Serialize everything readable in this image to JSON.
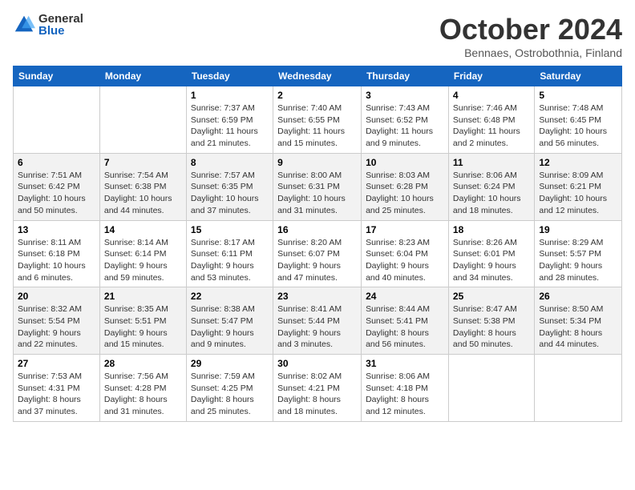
{
  "header": {
    "logo_general": "General",
    "logo_blue": "Blue",
    "month_title": "October 2024",
    "subtitle": "Bennaes, Ostrobothnia, Finland"
  },
  "weekdays": [
    "Sunday",
    "Monday",
    "Tuesday",
    "Wednesday",
    "Thursday",
    "Friday",
    "Saturday"
  ],
  "rows": [
    [
      {
        "day": "",
        "info": ""
      },
      {
        "day": "",
        "info": ""
      },
      {
        "day": "1",
        "info": "Sunrise: 7:37 AM\nSunset: 6:59 PM\nDaylight: 11 hours\nand 21 minutes."
      },
      {
        "day": "2",
        "info": "Sunrise: 7:40 AM\nSunset: 6:55 PM\nDaylight: 11 hours\nand 15 minutes."
      },
      {
        "day": "3",
        "info": "Sunrise: 7:43 AM\nSunset: 6:52 PM\nDaylight: 11 hours\nand 9 minutes."
      },
      {
        "day": "4",
        "info": "Sunrise: 7:46 AM\nSunset: 6:48 PM\nDaylight: 11 hours\nand 2 minutes."
      },
      {
        "day": "5",
        "info": "Sunrise: 7:48 AM\nSunset: 6:45 PM\nDaylight: 10 hours\nand 56 minutes."
      }
    ],
    [
      {
        "day": "6",
        "info": "Sunrise: 7:51 AM\nSunset: 6:42 PM\nDaylight: 10 hours\nand 50 minutes."
      },
      {
        "day": "7",
        "info": "Sunrise: 7:54 AM\nSunset: 6:38 PM\nDaylight: 10 hours\nand 44 minutes."
      },
      {
        "day": "8",
        "info": "Sunrise: 7:57 AM\nSunset: 6:35 PM\nDaylight: 10 hours\nand 37 minutes."
      },
      {
        "day": "9",
        "info": "Sunrise: 8:00 AM\nSunset: 6:31 PM\nDaylight: 10 hours\nand 31 minutes."
      },
      {
        "day": "10",
        "info": "Sunrise: 8:03 AM\nSunset: 6:28 PM\nDaylight: 10 hours\nand 25 minutes."
      },
      {
        "day": "11",
        "info": "Sunrise: 8:06 AM\nSunset: 6:24 PM\nDaylight: 10 hours\nand 18 minutes."
      },
      {
        "day": "12",
        "info": "Sunrise: 8:09 AM\nSunset: 6:21 PM\nDaylight: 10 hours\nand 12 minutes."
      }
    ],
    [
      {
        "day": "13",
        "info": "Sunrise: 8:11 AM\nSunset: 6:18 PM\nDaylight: 10 hours\nand 6 minutes."
      },
      {
        "day": "14",
        "info": "Sunrise: 8:14 AM\nSunset: 6:14 PM\nDaylight: 9 hours\nand 59 minutes."
      },
      {
        "day": "15",
        "info": "Sunrise: 8:17 AM\nSunset: 6:11 PM\nDaylight: 9 hours\nand 53 minutes."
      },
      {
        "day": "16",
        "info": "Sunrise: 8:20 AM\nSunset: 6:07 PM\nDaylight: 9 hours\nand 47 minutes."
      },
      {
        "day": "17",
        "info": "Sunrise: 8:23 AM\nSunset: 6:04 PM\nDaylight: 9 hours\nand 40 minutes."
      },
      {
        "day": "18",
        "info": "Sunrise: 8:26 AM\nSunset: 6:01 PM\nDaylight: 9 hours\nand 34 minutes."
      },
      {
        "day": "19",
        "info": "Sunrise: 8:29 AM\nSunset: 5:57 PM\nDaylight: 9 hours\nand 28 minutes."
      }
    ],
    [
      {
        "day": "20",
        "info": "Sunrise: 8:32 AM\nSunset: 5:54 PM\nDaylight: 9 hours\nand 22 minutes."
      },
      {
        "day": "21",
        "info": "Sunrise: 8:35 AM\nSunset: 5:51 PM\nDaylight: 9 hours\nand 15 minutes."
      },
      {
        "day": "22",
        "info": "Sunrise: 8:38 AM\nSunset: 5:47 PM\nDaylight: 9 hours\nand 9 minutes."
      },
      {
        "day": "23",
        "info": "Sunrise: 8:41 AM\nSunset: 5:44 PM\nDaylight: 9 hours\nand 3 minutes."
      },
      {
        "day": "24",
        "info": "Sunrise: 8:44 AM\nSunset: 5:41 PM\nDaylight: 8 hours\nand 56 minutes."
      },
      {
        "day": "25",
        "info": "Sunrise: 8:47 AM\nSunset: 5:38 PM\nDaylight: 8 hours\nand 50 minutes."
      },
      {
        "day": "26",
        "info": "Sunrise: 8:50 AM\nSunset: 5:34 PM\nDaylight: 8 hours\nand 44 minutes."
      }
    ],
    [
      {
        "day": "27",
        "info": "Sunrise: 7:53 AM\nSunset: 4:31 PM\nDaylight: 8 hours\nand 37 minutes."
      },
      {
        "day": "28",
        "info": "Sunrise: 7:56 AM\nSunset: 4:28 PM\nDaylight: 8 hours\nand 31 minutes."
      },
      {
        "day": "29",
        "info": "Sunrise: 7:59 AM\nSunset: 4:25 PM\nDaylight: 8 hours\nand 25 minutes."
      },
      {
        "day": "30",
        "info": "Sunrise: 8:02 AM\nSunset: 4:21 PM\nDaylight: 8 hours\nand 18 minutes."
      },
      {
        "day": "31",
        "info": "Sunrise: 8:06 AM\nSunset: 4:18 PM\nDaylight: 8 hours\nand 12 minutes."
      },
      {
        "day": "",
        "info": ""
      },
      {
        "day": "",
        "info": ""
      }
    ]
  ]
}
